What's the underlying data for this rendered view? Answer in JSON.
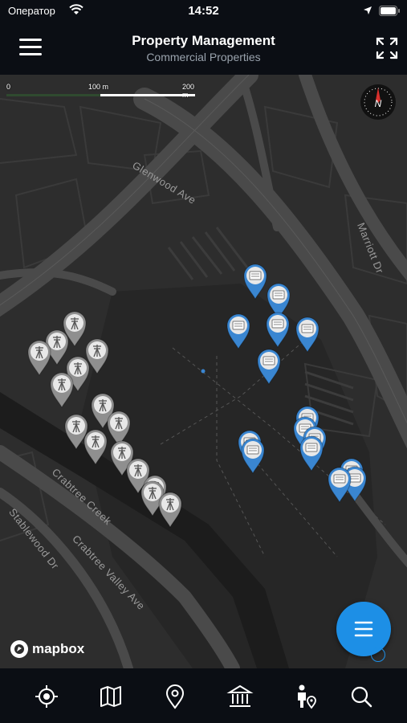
{
  "status_bar": {
    "carrier": "Оператор",
    "time": "14:52"
  },
  "header": {
    "title": "Property Management",
    "subtitle": "Commercial Properties"
  },
  "map": {
    "scale": {
      "ticks": [
        "0",
        "100 m",
        "200 m"
      ]
    },
    "compass_label": "N",
    "roads": {
      "glenwood": "Glenwood Ave",
      "marriott": "Marriott Dr",
      "crabtree_creek": "Crabtree Creek",
      "crabtree_valley": "Crabtree Valley Ave",
      "stablewood": "Stablewood Dr"
    },
    "attribution": "mapbox",
    "marker_counts": {
      "commercial_blue": 15,
      "tower_gray": 16
    },
    "colors": {
      "commercial_pin": "#3a86d1",
      "tower_pin": "#8f8f8f",
      "accent": "#1d8fe6"
    }
  },
  "bottom_nav": [
    {
      "icon": "locate-icon"
    },
    {
      "icon": "map-icon"
    },
    {
      "icon": "pin-icon"
    },
    {
      "icon": "bank-icon"
    },
    {
      "icon": "person-location-icon"
    },
    {
      "icon": "search-icon"
    }
  ]
}
